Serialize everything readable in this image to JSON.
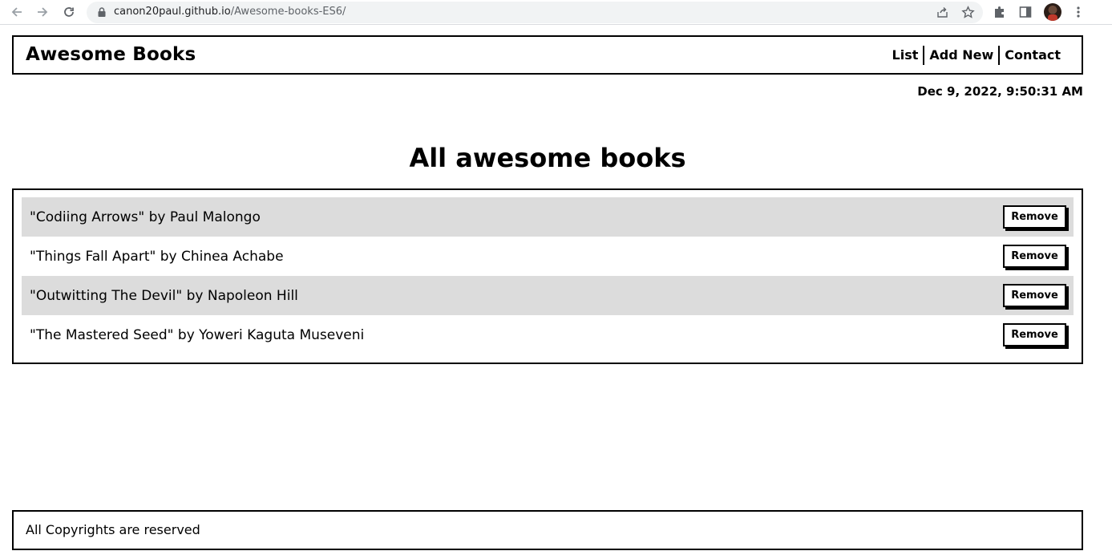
{
  "browser": {
    "url_host": "canon20paul.github.io",
    "url_path": "/Awesome-books-ES6/"
  },
  "header": {
    "brand": "Awesome Books",
    "nav": [
      {
        "label": "List"
      },
      {
        "label": "Add New"
      },
      {
        "label": "Contact"
      }
    ]
  },
  "datetime": "Dec 9, 2022, 9:50:31 AM",
  "main": {
    "title": "All awesome books",
    "books": [
      {
        "text": "\"Codiing Arrows\" by Paul Malongo",
        "action": "Remove"
      },
      {
        "text": "\"Things Fall Apart\" by Chinea Achabe",
        "action": "Remove"
      },
      {
        "text": "\"Outwitting The Devil\" by Napoleon Hill",
        "action": "Remove"
      },
      {
        "text": "\"The Mastered Seed\" by Yoweri Kaguta Museveni",
        "action": "Remove"
      }
    ]
  },
  "footer": {
    "text": "All Copyrights are reserved"
  },
  "colors": {
    "border": "#000000",
    "row_shade": "#dcdcdc",
    "background": "#ffffff"
  }
}
